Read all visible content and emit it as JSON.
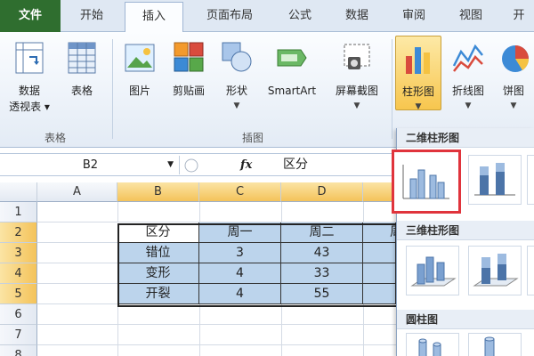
{
  "ribbon_tabs": [
    "文件",
    "开始",
    "插入",
    "页面布局",
    "公式",
    "数据",
    "审阅",
    "视图",
    "开"
  ],
  "ribbon": {
    "table_group": {
      "label": "表格",
      "pivot_line1": "数据",
      "pivot_line2": "透视表 ▾",
      "table": "表格"
    },
    "illustrations_group": {
      "label": "插图",
      "picture": "图片",
      "clipart": "剪贴画",
      "shapes": "形状",
      "smartart": "SmartArt",
      "screenshot": "屏幕截图"
    },
    "charts": {
      "column": "柱形图",
      "line": "折线图",
      "pie": "饼图"
    }
  },
  "formula_bar": {
    "name_box": "B2",
    "fx": "fx",
    "content": "区分"
  },
  "columns": [
    "A",
    "B",
    "C",
    "D"
  ],
  "rows": [
    "1",
    "2",
    "3",
    "4",
    "5",
    "6",
    "7",
    "8"
  ],
  "table": {
    "headers": [
      "区分",
      "周一",
      "周二",
      "周"
    ],
    "rows": [
      [
        "错位",
        "3",
        "43"
      ],
      [
        "变形",
        "4",
        "33"
      ],
      [
        "开裂",
        "4",
        "55"
      ]
    ]
  },
  "dropdown": {
    "sections": [
      "二维柱形图",
      "三维柱形图",
      "圆柱图"
    ]
  },
  "colors": {
    "file_tab": "#2f6e2f",
    "selection_highlight": "#f4c35a",
    "table_fill": "#bcd4ec",
    "callout": "#e0343c"
  }
}
